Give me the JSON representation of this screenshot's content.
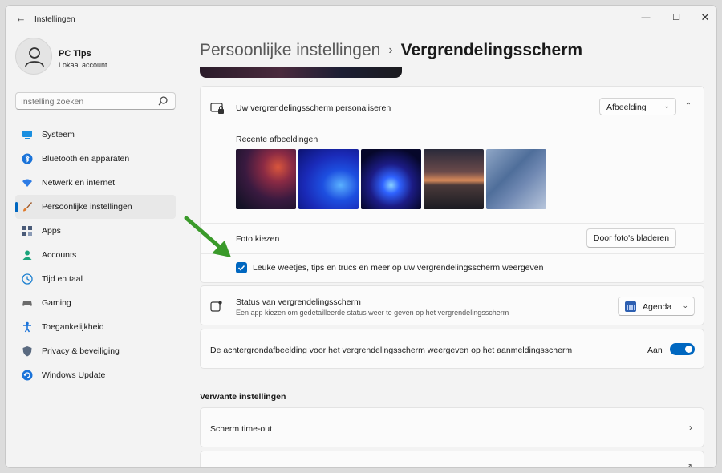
{
  "window": {
    "title": "Instellingen",
    "controls": {
      "minimize": "—",
      "maximize": "☐",
      "close": "✕"
    },
    "back": "←"
  },
  "profile": {
    "name": "PC Tips",
    "account_type": "Lokaal account"
  },
  "search": {
    "placeholder": "Instelling zoeken",
    "value": ""
  },
  "sidebar": {
    "items": [
      {
        "label": "Systeem",
        "icon": "monitor-icon",
        "color": "#1a8fe0"
      },
      {
        "label": "Bluetooth en apparaten",
        "icon": "bluetooth-icon",
        "color": "#1a73d9"
      },
      {
        "label": "Netwerk en internet",
        "icon": "wifi-icon",
        "color": "#2c7be5"
      },
      {
        "label": "Persoonlijke instellingen",
        "icon": "brush-icon",
        "color": "#e07a2a",
        "active": true
      },
      {
        "label": "Apps",
        "icon": "apps-icon",
        "color": "#4a5b78"
      },
      {
        "label": "Accounts",
        "icon": "person-icon",
        "color": "#1aa37a"
      },
      {
        "label": "Tijd en taal",
        "icon": "globe-clock-icon",
        "color": "#1a7fd0"
      },
      {
        "label": "Gaming",
        "icon": "controller-icon",
        "color": "#6b6b6b"
      },
      {
        "label": "Toegankelijkheid",
        "icon": "accessibility-icon",
        "color": "#1a73d9"
      },
      {
        "label": "Privacy & beveiliging",
        "icon": "shield-icon",
        "color": "#5a6a80"
      },
      {
        "label": "Windows Update",
        "icon": "update-icon",
        "color": "#1a73d9"
      }
    ]
  },
  "breadcrumb": {
    "parent": "Persoonlijke instellingen",
    "separator": "›",
    "current": "Vergrendelingsscherm"
  },
  "personalize": {
    "title": "Uw vergrendelingsscherm personaliseren",
    "dropdown_value": "Afbeelding",
    "recent_label": "Recente afbeeldingen",
    "choose_photo_label": "Foto kiezen",
    "browse_button": "Door foto's bladeren",
    "tips_checkbox_label": "Leuke weetjes, tips en trucs en meer op uw vergrendelingsscherm weergeven",
    "tips_checked": true
  },
  "status": {
    "title": "Status van vergrendelingsscherm",
    "subtitle": "Een app kiezen om gedetailleerde status weer te geven op het vergrendelingsscherm",
    "dropdown_value": "Agenda"
  },
  "background_toggle": {
    "label": "De achtergrondafbeelding voor het vergrendelingsscherm weergeven op het aanmeldingsscherm",
    "state_label": "Aan",
    "on": true
  },
  "related": {
    "heading": "Verwante instellingen",
    "items": [
      {
        "label": "Scherm time-out"
      }
    ]
  },
  "colors": {
    "accent": "#0067c0",
    "annotation_arrow": "#3a9a2a"
  }
}
